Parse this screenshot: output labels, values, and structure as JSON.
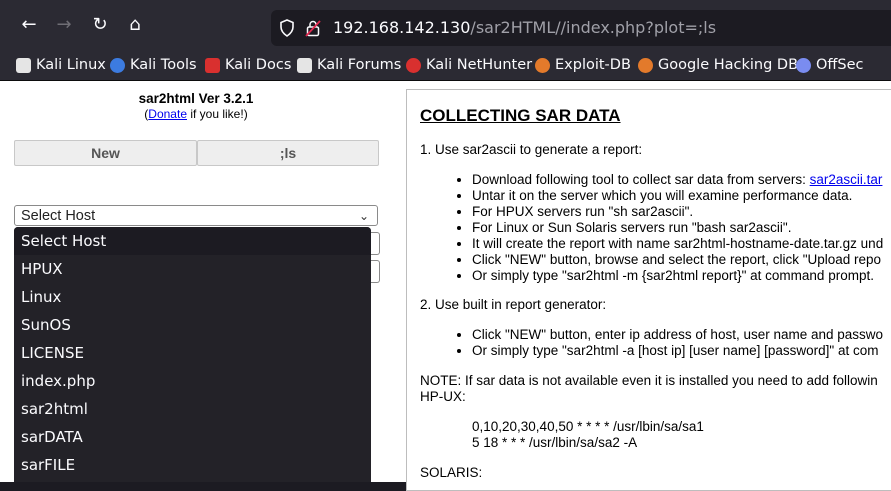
{
  "browser": {
    "url_host": "192.168.142.130",
    "url_path": "/sar2HTML//index.php?plot=;ls",
    "bookmarks": [
      {
        "label": "Kali Linux",
        "icon": "kali-dragon-icon",
        "color": "#e5e5e5"
      },
      {
        "label": "Kali Tools",
        "icon": "kali-tools-icon",
        "color": "#3c7be0"
      },
      {
        "label": "Kali Docs",
        "icon": "kali-docs-icon",
        "color": "#d9302f"
      },
      {
        "label": "Kali Forums",
        "icon": "kali-forums-icon",
        "color": "#e5e5e5"
      },
      {
        "label": "Kali NetHunter",
        "icon": "nethunter-icon",
        "color": "#d9302f"
      },
      {
        "label": "Exploit-DB",
        "icon": "exploit-db-icon",
        "color": "#e37a2b"
      },
      {
        "label": "Google Hacking DB",
        "icon": "ghdb-icon",
        "color": "#e37a2b"
      },
      {
        "label": "OffSec",
        "icon": "offsec-icon",
        "color": "#7a8cf0"
      }
    ]
  },
  "left": {
    "title": "sar2html Ver 3.2.1",
    "donate_open": "(",
    "donate_link": "Donate",
    "donate_rest": " if you like!)",
    "new_button": "New",
    "ls_button": ";ls",
    "select_value": "Select Host",
    "options": [
      "Select Host",
      "HPUX",
      "Linux",
      "SunOS",
      "LICENSE",
      "index.php",
      "sar2html",
      "sarDATA",
      "sarFILE"
    ]
  },
  "right": {
    "heading": "COLLECTING SAR DATA",
    "step1": "1. Use sar2ascii to generate a report:",
    "step1_link_prefix": "Download following tool to collect sar data from servers: ",
    "step1_link": "sar2ascii.tar",
    "step1_items": [
      "Untar it on the server which you will examine performance data.",
      "For HPUX servers run \"sh sar2ascii\".",
      "For Linux or Sun Solaris servers run \"bash sar2ascii\".",
      "It will create the report with name sar2html-hostname-date.tar.gz und",
      "Click \"NEW\" button, browse and select the report, click \"Upload repo",
      "Or simply type \"sar2html -m {sar2html report}\" at command prompt."
    ],
    "step2": "2. Use built in report generator:",
    "step2_items": [
      "Click \"NEW\" button, enter ip address of host, user name and passwo",
      "Or simply type \"sar2html -a [host ip] [user name] [password]\" at com"
    ],
    "note_line1": "NOTE: If sar data is not available even it is installed you need to add followin",
    "note_line2": "HP-UX:",
    "cron1": "0,10,20,30,40,50 * * * * /usr/lbin/sa/sa1",
    "cron2": "5 18 * * * /usr/lbin/sa/sa2 -A",
    "solaris": "SOLARIS:"
  }
}
